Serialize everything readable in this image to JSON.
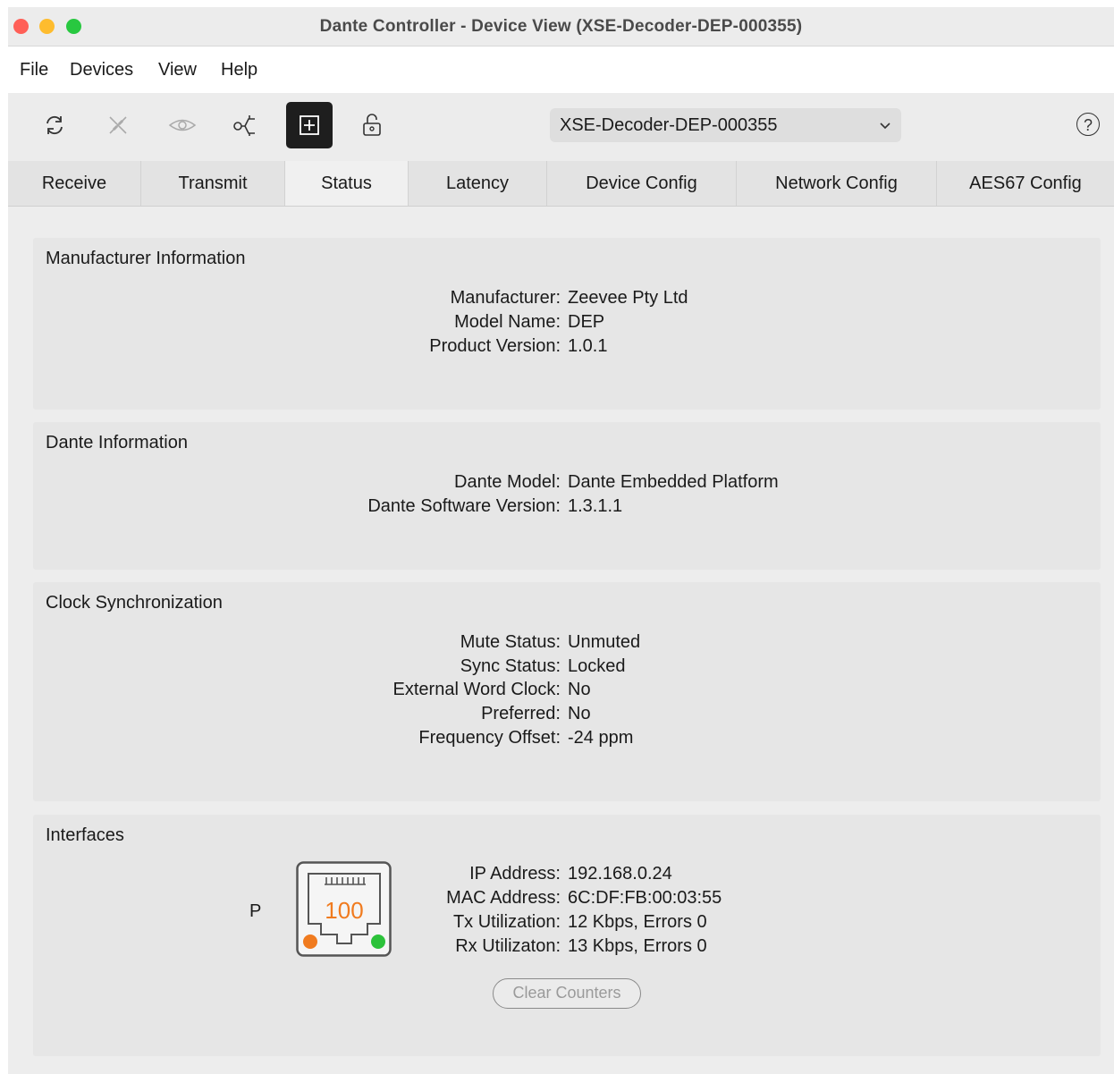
{
  "window": {
    "title": "Dante Controller - Device View (XSE-Decoder-DEP-000355)"
  },
  "menu": [
    "File",
    "Devices",
    "View",
    "Help"
  ],
  "toolbar": {
    "device_name": "XSE-Decoder-DEP-000355",
    "help_label": "?"
  },
  "tabs": [
    {
      "label": "Receive",
      "selected": false
    },
    {
      "label": "Transmit",
      "selected": false
    },
    {
      "label": "Status",
      "selected": true
    },
    {
      "label": "Latency",
      "selected": false
    },
    {
      "label": "Device Config",
      "selected": false
    },
    {
      "label": "Network Config",
      "selected": false
    },
    {
      "label": "AES67 Config",
      "selected": false
    }
  ],
  "manufacturer": {
    "title": "Manufacturer Information",
    "rows": [
      {
        "label": "Manufacturer:",
        "value": "Zeevee Pty Ltd"
      },
      {
        "label": "Model Name:",
        "value": "DEP"
      },
      {
        "label": "Product Version:",
        "value": "1.0.1"
      }
    ]
  },
  "dante": {
    "title": "Dante Information",
    "rows": [
      {
        "label": "Dante Model:",
        "value": "Dante Embedded Platform"
      },
      {
        "label": "Dante Software Version:",
        "value": "1.3.1.1"
      }
    ]
  },
  "clock": {
    "title": "Clock Synchronization",
    "rows": [
      {
        "label": "Mute Status:",
        "value": "Unmuted"
      },
      {
        "label": "Sync Status:",
        "value": "Locked"
      },
      {
        "label": "External Word Clock:",
        "value": "No"
      },
      {
        "label": "Preferred:",
        "value": "No"
      },
      {
        "label": "Frequency Offset:",
        "value": "-24 ppm"
      }
    ]
  },
  "interfaces": {
    "title": "Interfaces",
    "port_label": "P",
    "port_speed": "100",
    "rows": [
      {
        "label": "IP Address:",
        "value": "192.168.0.24"
      },
      {
        "label": "MAC Address:",
        "value": "6C:DF:FB:00:03:55"
      },
      {
        "label": "Tx Utilization:",
        "value": "12 Kbps, Errors 0"
      },
      {
        "label": "Rx Utilizaton:",
        "value": "13 Kbps, Errors 0"
      }
    ],
    "clear_button": "Clear Counters"
  },
  "colors": {
    "port_speed": "#f07b1f",
    "led_orange": "#f07b1f",
    "led_green": "#2cc23a",
    "tool_active_bg": "#1e1e1e"
  }
}
